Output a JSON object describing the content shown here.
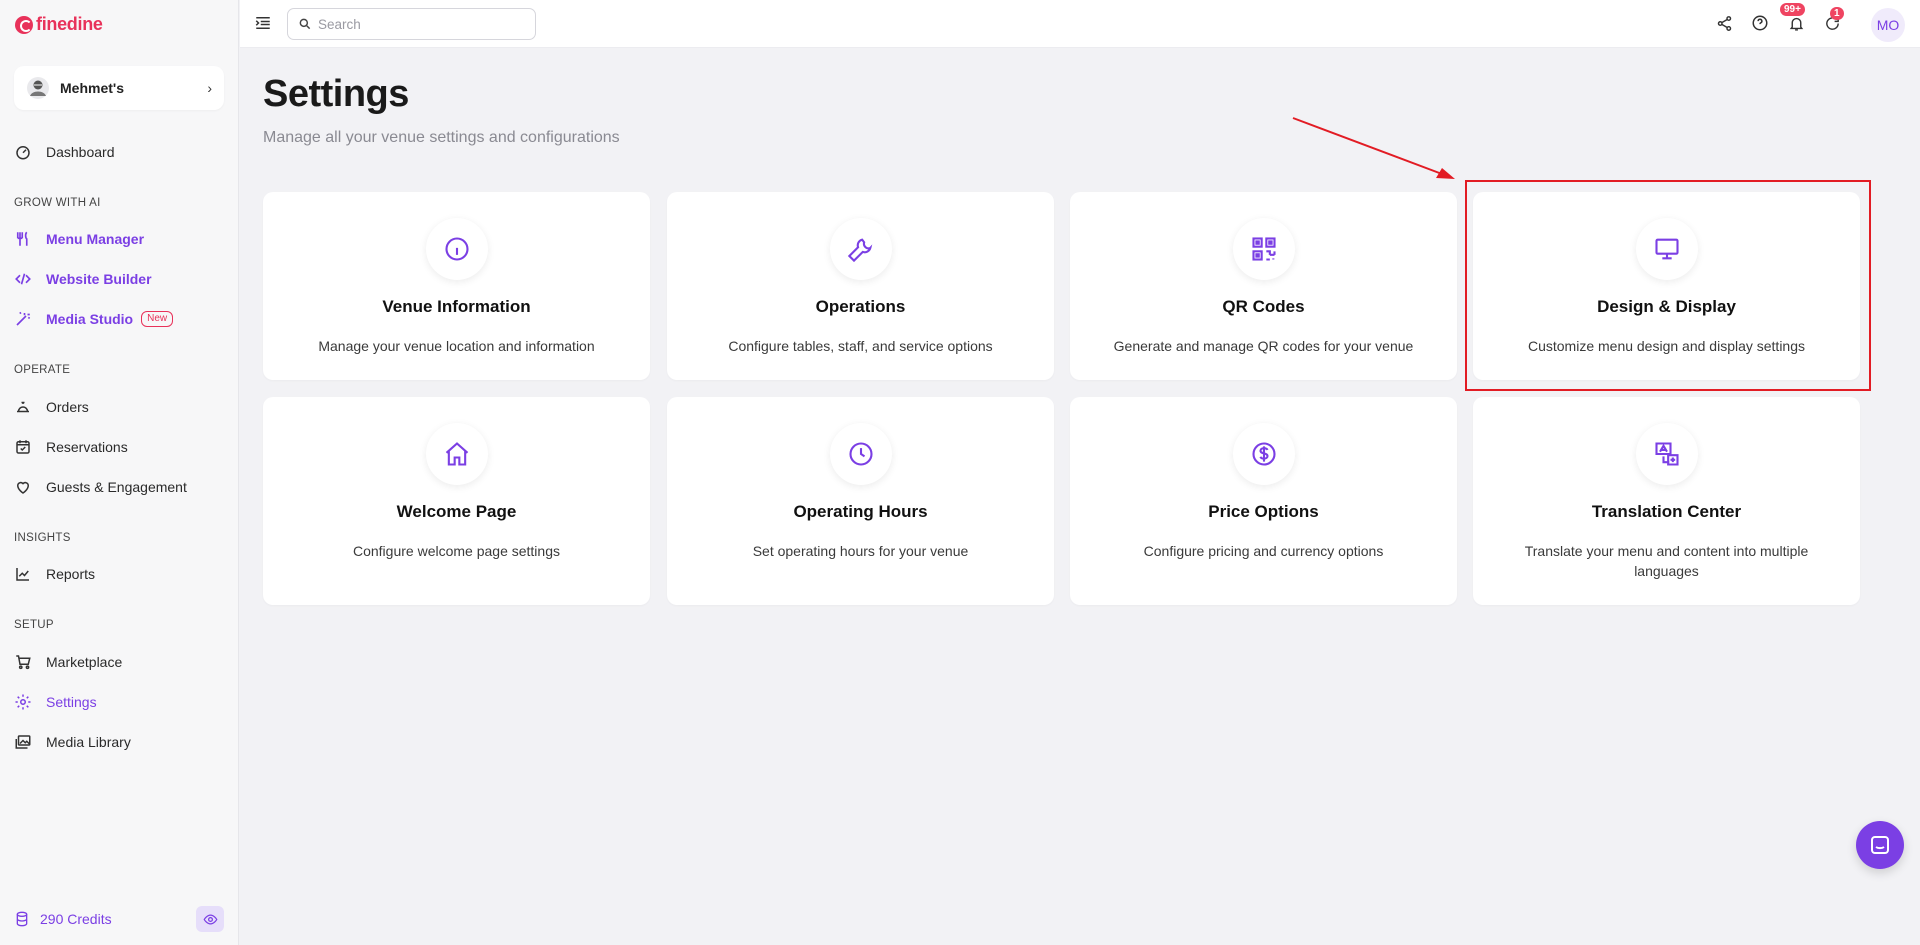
{
  "brand": {
    "name": "finedine",
    "color": "#e8325a"
  },
  "accent": "#7b3fe4",
  "venue": {
    "name": "Mehmet's"
  },
  "sidebar": {
    "top_items": [
      {
        "label": "Dashboard",
        "icon": "dashboard-icon"
      }
    ],
    "sections": [
      {
        "title": "GROW WITH AI",
        "items": [
          {
            "label": "Menu Manager",
            "icon": "utensils-icon"
          },
          {
            "label": "Website Builder",
            "icon": "code-icon"
          },
          {
            "label": "Media Studio",
            "icon": "magic-wand-icon",
            "badge": "New"
          }
        ]
      },
      {
        "title": "OPERATE",
        "items": [
          {
            "label": "Orders",
            "icon": "bell-service-icon"
          },
          {
            "label": "Reservations",
            "icon": "calendar-check-icon"
          },
          {
            "label": "Guests & Engagement",
            "icon": "heart-icon"
          }
        ]
      },
      {
        "title": "INSIGHTS",
        "items": [
          {
            "label": "Reports",
            "icon": "chart-line-icon"
          }
        ]
      },
      {
        "title": "SETUP",
        "items": [
          {
            "label": "Marketplace",
            "icon": "cart-icon"
          },
          {
            "label": "Settings",
            "icon": "gear-icon"
          },
          {
            "label": "Media Library",
            "icon": "images-icon"
          }
        ]
      }
    ],
    "credits": "290 Credits"
  },
  "header": {
    "search_placeholder": "Search",
    "notifications_badge": "99+",
    "updates_badge": "1",
    "user_initials": "MO"
  },
  "page": {
    "title": "Settings",
    "subtitle": "Manage all your venue settings and configurations"
  },
  "cards": [
    {
      "title": "Venue Information",
      "description": "Manage your venue location and information",
      "icon": "info-icon"
    },
    {
      "title": "Operations",
      "description": "Configure tables, staff, and service options",
      "icon": "wrench-icon"
    },
    {
      "title": "QR Codes",
      "description": "Generate and manage QR codes for your venue",
      "icon": "qr-code-icon"
    },
    {
      "title": "Design & Display",
      "description": "Customize menu design and display settings",
      "icon": "monitor-icon"
    },
    {
      "title": "Welcome Page",
      "description": "Configure welcome page settings",
      "icon": "home-icon"
    },
    {
      "title": "Operating Hours",
      "description": "Set operating hours for your venue",
      "icon": "clock-icon"
    },
    {
      "title": "Price Options",
      "description": "Configure pricing and currency options",
      "icon": "dollar-circle-icon"
    },
    {
      "title": "Translation Center",
      "description": "Translate your menu and content into multiple languages",
      "icon": "translate-icon"
    }
  ],
  "annotation": {
    "highlight_color": "#e21c24"
  }
}
